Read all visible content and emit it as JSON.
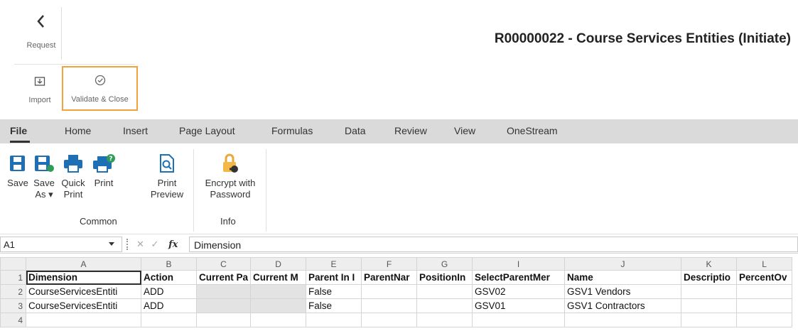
{
  "header": {
    "title": "R00000022  - Course Services Entities (Initiate)",
    "request_label": "Request",
    "import_label": "Import",
    "validate_label": "Validate & Close"
  },
  "menu": {
    "tabs": [
      "File",
      "Home",
      "Insert",
      "Page Layout",
      "Formulas",
      "Data",
      "Review",
      "View",
      "OneStream"
    ],
    "active": "File"
  },
  "ribbon": {
    "save": "Save",
    "save_as_1": "Save",
    "save_as_2": "As ▾",
    "quick_print_1": "Quick",
    "quick_print_2": "Print",
    "print": "Print",
    "print_preview_1": "Print",
    "print_preview_2": "Preview",
    "encrypt_1": "Encrypt with",
    "encrypt_2": "Password",
    "group_common": "Common",
    "group_info": "Info"
  },
  "formula_bar": {
    "cell_ref": "A1",
    "formula": "Dimension"
  },
  "sheet": {
    "columns": [
      "A",
      "B",
      "C",
      "D",
      "E",
      "F",
      "G",
      "I",
      "J",
      "K",
      "L"
    ],
    "rows": [
      {
        "num": "1",
        "cells": [
          "Dimension",
          "Action",
          "Current Pa",
          "Current M",
          "Parent In I",
          "ParentNar",
          "PositionIn",
          "SelectParentMer",
          "Name",
          "Descriptio",
          "PercentOv"
        ]
      },
      {
        "num": "2",
        "cells": [
          "CourseServicesEntiti",
          "ADD",
          "",
          "",
          "False",
          "",
          "",
          "GSV02",
          "GSV1 Vendors",
          "",
          ""
        ]
      },
      {
        "num": "3",
        "cells": [
          "CourseServicesEntiti",
          "ADD",
          "",
          "",
          "False",
          "",
          "",
          "GSV01",
          "GSV1 Contractors",
          "",
          ""
        ]
      },
      {
        "num": "4",
        "cells": [
          "",
          "",
          "",
          "",
          "",
          "",
          "",
          "",
          "",
          "",
          ""
        ]
      }
    ]
  },
  "colors": {
    "accent_orange": "#f2a23a",
    "menubar_bg": "#dadada",
    "icon_blue": "#1f6fb5",
    "icon_gold": "#e8a93a"
  }
}
